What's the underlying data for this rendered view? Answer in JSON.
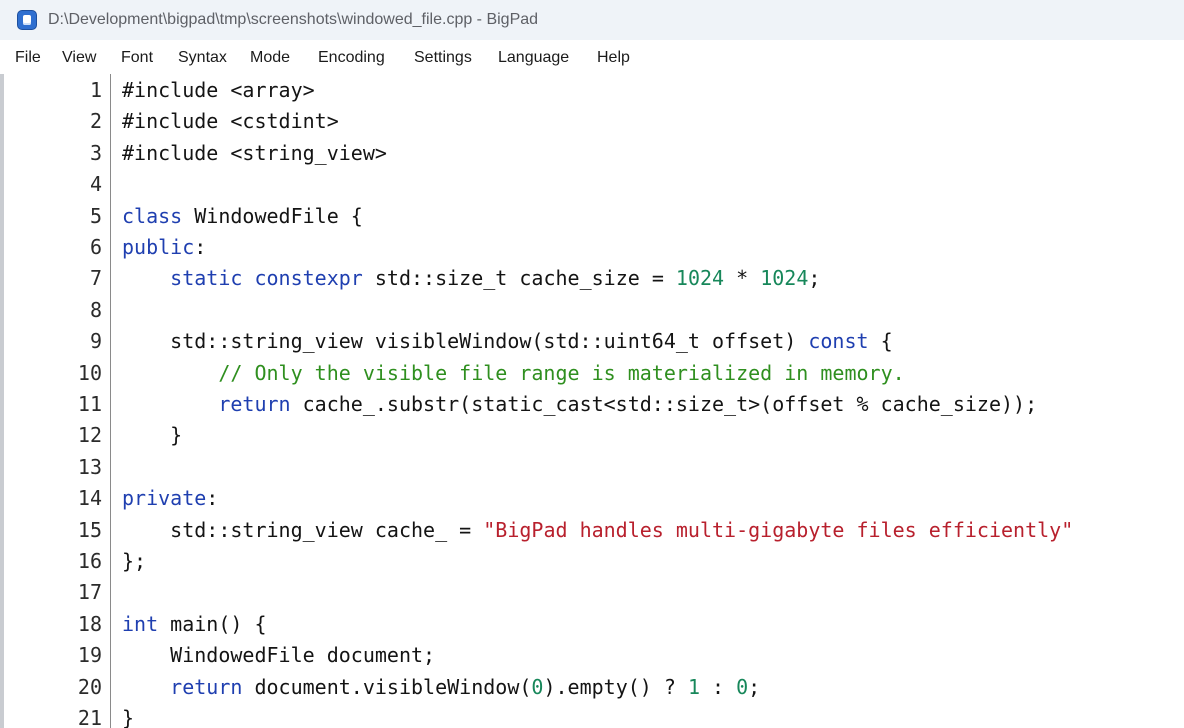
{
  "window": {
    "title": "D:\\Development\\bigpad\\tmp\\screenshots\\windowed_file.cpp - BigPad",
    "app_icon": "bigpad-app-icon"
  },
  "menu": [
    {
      "id": "file",
      "label": "File"
    },
    {
      "id": "view",
      "label": "View"
    },
    {
      "id": "font",
      "label": "Font"
    },
    {
      "id": "syntax",
      "label": "Syntax"
    },
    {
      "id": "mode",
      "label": "Mode"
    },
    {
      "id": "encoding",
      "label": "Encoding"
    },
    {
      "id": "settings",
      "label": "Settings"
    },
    {
      "id": "language",
      "label": "Language"
    },
    {
      "id": "help",
      "label": "Help"
    }
  ],
  "colors": {
    "keyword": "#1f3fb0",
    "number": "#17875a",
    "string": "#b8202d",
    "comment": "#2f8f1f"
  },
  "editor": {
    "lines": [
      {
        "number": "1",
        "tokens": [
          {
            "t": "#include <array>",
            "c": "plain"
          }
        ]
      },
      {
        "number": "2",
        "tokens": [
          {
            "t": "#include <cstdint>",
            "c": "plain"
          }
        ]
      },
      {
        "number": "3",
        "tokens": [
          {
            "t": "#include <string_view>",
            "c": "plain"
          }
        ]
      },
      {
        "number": "4",
        "tokens": []
      },
      {
        "number": "5",
        "tokens": [
          {
            "t": "class",
            "c": "kw"
          },
          {
            "t": " WindowedFile {",
            "c": "plain"
          }
        ]
      },
      {
        "number": "6",
        "tokens": [
          {
            "t": "public",
            "c": "kw"
          },
          {
            "t": ":",
            "c": "plain"
          }
        ]
      },
      {
        "number": "7",
        "tokens": [
          {
            "t": "    ",
            "c": "plain"
          },
          {
            "t": "static",
            "c": "kw"
          },
          {
            "t": " ",
            "c": "plain"
          },
          {
            "t": "constexpr",
            "c": "kw"
          },
          {
            "t": " std::size_t cache_size = ",
            "c": "plain"
          },
          {
            "t": "1024",
            "c": "num"
          },
          {
            "t": " * ",
            "c": "plain"
          },
          {
            "t": "1024",
            "c": "num"
          },
          {
            "t": ";",
            "c": "plain"
          }
        ]
      },
      {
        "number": "8",
        "tokens": []
      },
      {
        "number": "9",
        "tokens": [
          {
            "t": "    std::string_view visibleWindow(std::uint64_t offset) ",
            "c": "plain"
          },
          {
            "t": "const",
            "c": "kw"
          },
          {
            "t": " {",
            "c": "plain"
          }
        ]
      },
      {
        "number": "10",
        "tokens": [
          {
            "t": "        ",
            "c": "plain"
          },
          {
            "t": "// Only the visible file range is materialized in memory.",
            "c": "cmt"
          }
        ]
      },
      {
        "number": "11",
        "tokens": [
          {
            "t": "        ",
            "c": "plain"
          },
          {
            "t": "return",
            "c": "kw"
          },
          {
            "t": " cache_.substr(static_cast<std::size_t>(offset % cache_size));",
            "c": "plain"
          }
        ]
      },
      {
        "number": "12",
        "tokens": [
          {
            "t": "    }",
            "c": "plain"
          }
        ]
      },
      {
        "number": "13",
        "tokens": []
      },
      {
        "number": "14",
        "tokens": [
          {
            "t": "private",
            "c": "kw"
          },
          {
            "t": ":",
            "c": "plain"
          }
        ]
      },
      {
        "number": "15",
        "tokens": [
          {
            "t": "    std::string_view cache_ = ",
            "c": "plain"
          },
          {
            "t": "\"BigPad handles multi-gigabyte files efficiently\"",
            "c": "str"
          }
        ]
      },
      {
        "number": "16",
        "tokens": [
          {
            "t": "};",
            "c": "plain"
          }
        ]
      },
      {
        "number": "17",
        "tokens": []
      },
      {
        "number": "18",
        "tokens": [
          {
            "t": "int",
            "c": "kw"
          },
          {
            "t": " main() {",
            "c": "plain"
          }
        ]
      },
      {
        "number": "19",
        "tokens": [
          {
            "t": "    WindowedFile document;",
            "c": "plain"
          }
        ]
      },
      {
        "number": "20",
        "tokens": [
          {
            "t": "    ",
            "c": "plain"
          },
          {
            "t": "return",
            "c": "kw"
          },
          {
            "t": " document.visibleWindow(",
            "c": "plain"
          },
          {
            "t": "0",
            "c": "num"
          },
          {
            "t": ").empty() ? ",
            "c": "plain"
          },
          {
            "t": "1",
            "c": "num"
          },
          {
            "t": " : ",
            "c": "plain"
          },
          {
            "t": "0",
            "c": "num"
          },
          {
            "t": ";",
            "c": "plain"
          }
        ]
      },
      {
        "number": "21",
        "tokens": [
          {
            "t": "}",
            "c": "plain"
          }
        ]
      }
    ]
  }
}
